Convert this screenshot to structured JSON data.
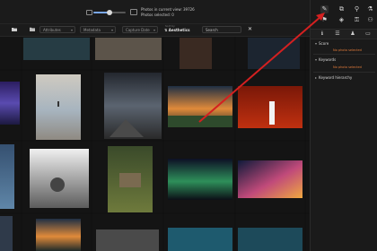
{
  "status": {
    "photos_in_view": "Photos in current view: 39726",
    "photos_selected": "Photos selected: 0"
  },
  "filters": {
    "attributes": "Attributes",
    "metadata": "Metadata",
    "capture_date": "Capture Date",
    "sort_label": "Sort by",
    "sort_value": "Aesthetics",
    "search_value": "Search"
  },
  "panel": {
    "sections": [
      {
        "title": "Score",
        "body": "No photo selected"
      },
      {
        "title": "Keywords",
        "body": "No photo selected"
      },
      {
        "title": "Keyword hierarchy",
        "body": ""
      }
    ]
  },
  "colors": {
    "accent": "#7aa7e8",
    "warning_text": "#e07a3a",
    "arrow": "#d42020"
  },
  "icons": {
    "clear": "✕",
    "sort": "⇅",
    "tools": [
      "pencil-icon",
      "layers-icon",
      "pin-icon",
      "eyedropper-icon",
      "flag-icon",
      "map-icon",
      "key-icon",
      "people-icon"
    ]
  }
}
